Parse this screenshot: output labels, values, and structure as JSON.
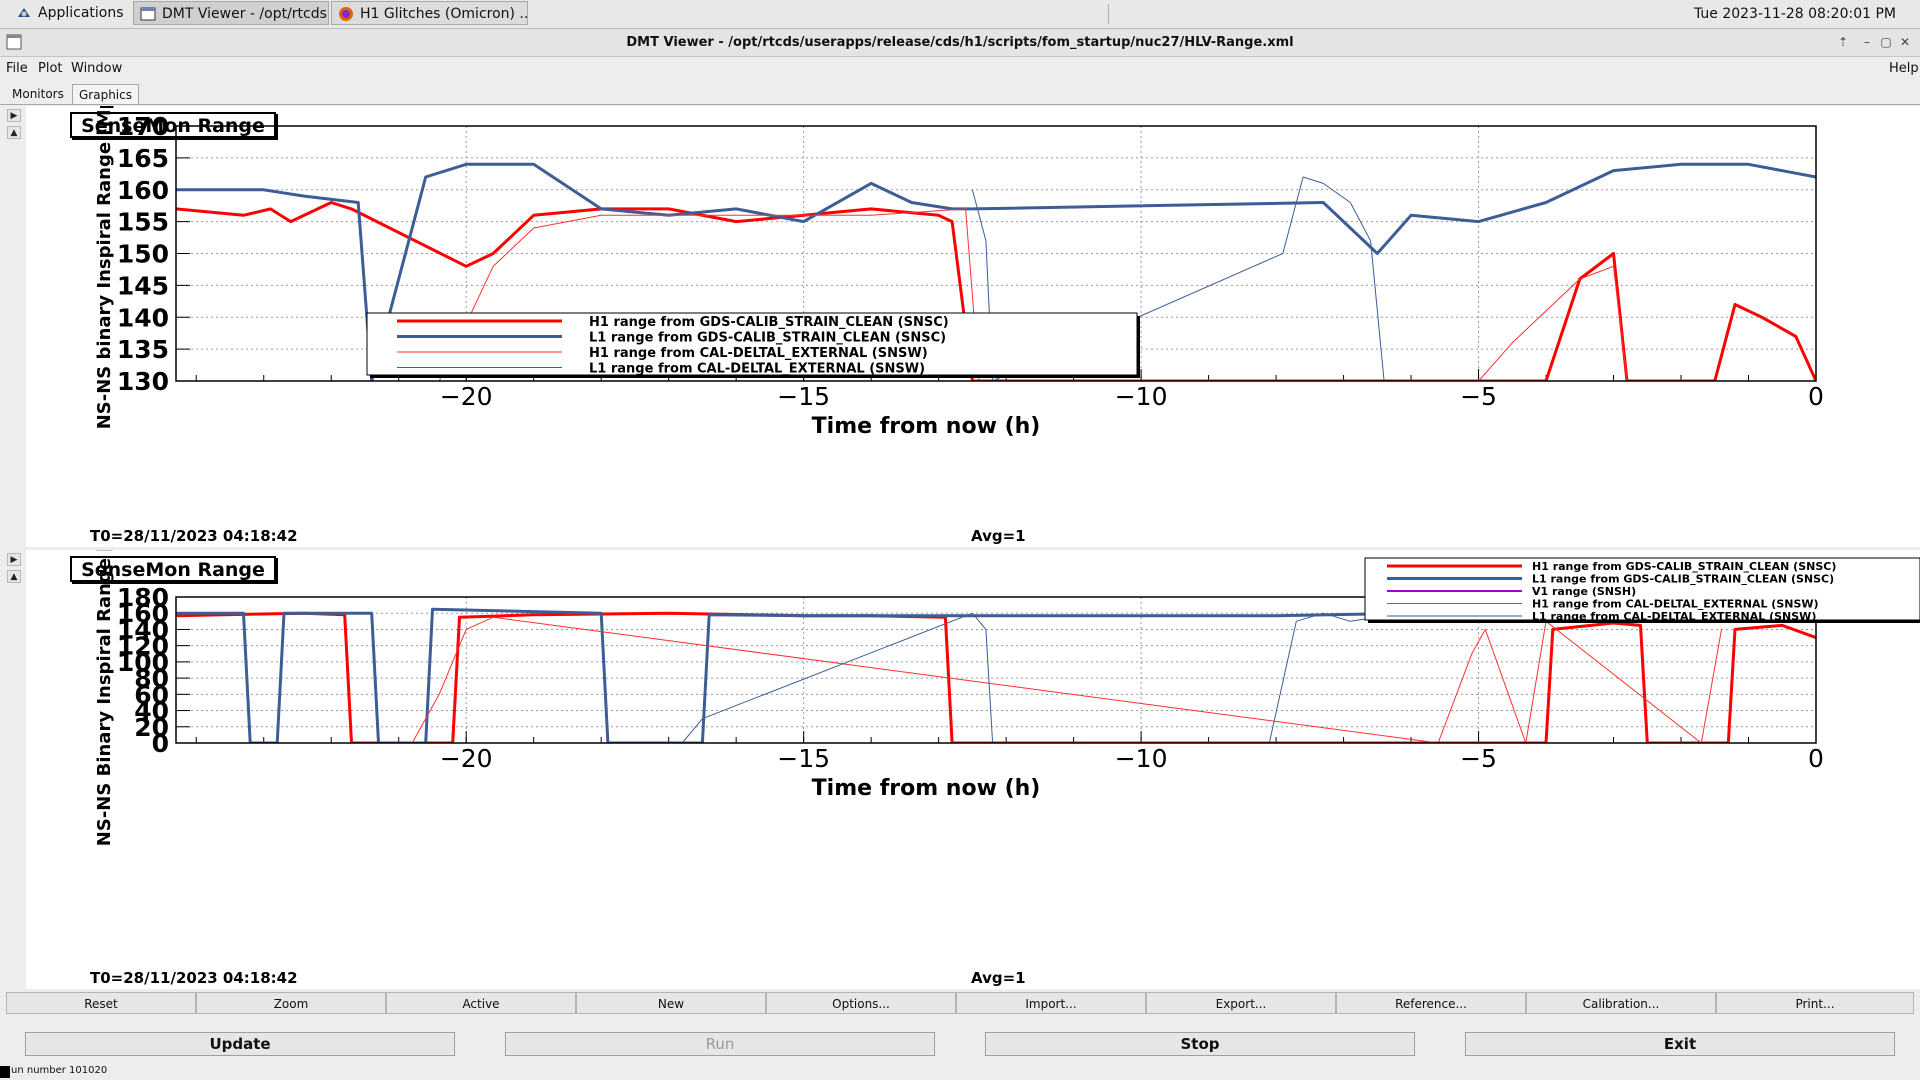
{
  "taskbar": {
    "items": [
      {
        "label": "Applications",
        "icon": "applications-icon"
      },
      {
        "label": "DMT Viewer - /opt/rtcds...",
        "icon": "window-icon"
      },
      {
        "label": "H1 Glitches (Omicron) ...",
        "icon": "firefox-icon"
      }
    ],
    "clock": "Tue 2023-11-28 08:20:01 PM"
  },
  "window": {
    "title": "DMT Viewer - /opt/rtcds/userapps/release/cds/h1/scripts/fom_startup/nuc27/HLV-Range.xml"
  },
  "menu": {
    "file": "File",
    "plot": "Plot",
    "window": "Window",
    "help": "Help"
  },
  "tabs": [
    {
      "label": "Monitors",
      "selected": false
    },
    {
      "label": "Graphics",
      "selected": true
    }
  ],
  "plots": [
    {
      "label": "SenseMon Range",
      "t0": "T0=28/11/2023 04:18:42",
      "avg": "Avg=1"
    },
    {
      "label": "SenseMon Range",
      "t0": "T0=28/11/2023 04:18:42",
      "avg": "Avg=1"
    }
  ],
  "chart_data": [
    {
      "type": "line",
      "title": "SenseMon Range",
      "xlabel": "Time from now (h)",
      "ylabel": "NS-NS binary Inspiral Range [Mpc]",
      "xlim": [
        -24.3,
        0
      ],
      "ylim": [
        130,
        170
      ],
      "xticks": [
        -20,
        -15,
        -10,
        -5,
        0
      ],
      "xtick_labels": [
        "−20",
        "−15",
        "−10",
        "−5",
        "0"
      ],
      "yticks": [
        130,
        135,
        140,
        145,
        150,
        155,
        160,
        165,
        170
      ],
      "grid": true,
      "legend_position": "center-left",
      "series": [
        {
          "name": "H1 range from GDS-CALIB_STRAIN_CLEAN (SNSC)",
          "color": "#ff0000",
          "width": 3,
          "x": [
            -24.3,
            -23.3,
            -22.9,
            -22.6,
            -22.0,
            -21.7,
            -20.0,
            -19.6,
            -19.0,
            -18.0,
            -17.0,
            -16.0,
            -15.0,
            -14.0,
            -13.0,
            -12.8,
            -12.5,
            -4.0,
            -3.5,
            -3.0,
            -2.8,
            -1.5,
            -1.2,
            -0.8,
            -0.3,
            0
          ],
          "y": [
            157,
            156,
            157,
            155,
            158,
            157,
            148,
            150,
            156,
            157,
            157,
            155,
            156,
            157,
            156,
            155,
            130,
            130,
            146,
            150,
            130,
            130,
            142,
            140,
            137,
            130
          ]
        },
        {
          "name": "L1 range from GDS-CALIB_STRAIN_CLEAN (SNSC)",
          "color": "#3d5d96",
          "width": 3,
          "x": [
            -24.3,
            -23.0,
            -22.4,
            -21.6,
            -21.4,
            -20.6,
            -20.0,
            -19.0,
            -18.0,
            -17.0,
            -16.0,
            -15.0,
            -14.0,
            -13.4,
            -12.8,
            -12.5,
            -7.3,
            -6.5,
            -6.0,
            -5.0,
            -4.0,
            -3.0,
            -2.0,
            -1.0,
            0
          ],
          "y": [
            160,
            160,
            159,
            158,
            130,
            162,
            164,
            164,
            157,
            156,
            157,
            155,
            161,
            158,
            157,
            157,
            158,
            150,
            156,
            155,
            158,
            163,
            164,
            164,
            162
          ]
        },
        {
          "name": "H1 range from CAL-DELTAL_EXTERNAL (SNSW)",
          "color": "#ff3030",
          "width": 1,
          "x": [
            -20.4,
            -19.6,
            -19.0,
            -18.0,
            -16.0,
            -14.0,
            -12.6,
            -12.4,
            -5.0,
            -4.5,
            -3.5,
            -3.0,
            -2.8
          ],
          "y": [
            130,
            148,
            154,
            156,
            156,
            156,
            157,
            130,
            130,
            136,
            146,
            148,
            130
          ]
        },
        {
          "name": "L1 range from CAL-DELTAL_EXTERNAL (SNSW)",
          "color": "#3d5d96",
          "width": 1,
          "x": [
            -12.5,
            -12.3,
            -12.2,
            -7.9,
            -7.6,
            -7.3,
            -6.9,
            -6.6,
            -6.4
          ],
          "y": [
            160,
            152,
            130,
            150,
            162,
            161,
            158,
            152,
            130
          ]
        }
      ]
    },
    {
      "type": "line",
      "title": "SenseMon Range",
      "xlabel": "Time from now (h)",
      "ylabel": "NS-NS Binary Inspiral Range [Mpc]",
      "xlim": [
        -24.3,
        0
      ],
      "ylim": [
        0,
        180
      ],
      "xticks": [
        -20,
        -15,
        -10,
        -5,
        0
      ],
      "xtick_labels": [
        "−20",
        "−15",
        "−10",
        "−5",
        "0"
      ],
      "yticks": [
        0,
        20,
        40,
        60,
        80,
        100,
        120,
        140,
        160,
        180
      ],
      "grid": true,
      "legend_position": "top-right",
      "series": [
        {
          "name": "H1 range from GDS-CALIB_STRAIN_CLEAN (SNSC)",
          "color": "#ff0000",
          "width": 3,
          "x": [
            -24.3,
            -22.4,
            -21.8,
            -21.7,
            -20.2,
            -20.1,
            -19.0,
            -17.0,
            -15.0,
            -14.0,
            -12.9,
            -12.8,
            -4.0,
            -3.9,
            -3.0,
            -2.6,
            -2.5,
            -1.3,
            -1.2,
            -0.5,
            0
          ],
          "y": [
            157,
            160,
            158,
            0,
            0,
            155,
            158,
            160,
            157,
            157,
            155,
            0,
            0,
            140,
            148,
            145,
            0,
            0,
            140,
            145,
            130
          ]
        },
        {
          "name": "L1 range from GDS-CALIB_STRAIN_CLEAN (SNSC)",
          "color": "#3d5d96",
          "width": 3,
          "x": [
            -24.3,
            -23.3,
            -23.2,
            -22.8,
            -22.7,
            -21.4,
            -21.3,
            -20.6,
            -20.5,
            -18.0,
            -17.9,
            -16.5,
            -16.4,
            -15.0,
            -13.0,
            -12.5,
            -8.0,
            -6.0,
            -4.0,
            -2.0,
            0
          ],
          "y": [
            160,
            160,
            0,
            0,
            160,
            160,
            0,
            0,
            165,
            160,
            0,
            0,
            158,
            157,
            157,
            157,
            157,
            160,
            162,
            164,
            163
          ]
        },
        {
          "name": "V1 range (SNSH)",
          "color": "#a000e0",
          "width": 2,
          "x": [],
          "y": []
        },
        {
          "name": "H1 range from CAL-DELTAL_EXTERNAL (SNSW)",
          "color": "#ff3030",
          "width": 1,
          "x": [
            -20.8,
            -20.4,
            -20.0,
            -19.6,
            -5.6,
            -5.1,
            -4.9,
            -4.3,
            -4.0,
            -1.7,
            -1.4
          ],
          "y": [
            0,
            60,
            140,
            155,
            0,
            110,
            140,
            0,
            150,
            0,
            140
          ]
        },
        {
          "name": "L1 range from CAL-DELTAL_EXTERNAL (SNSW)",
          "color": "#3d5d96",
          "width": 1,
          "x": [
            -16.8,
            -16.5,
            -12.5,
            -12.3,
            -12.2,
            -8.1,
            -7.7,
            -7.3,
            -6.9,
            -6.5
          ],
          "y": [
            0,
            30,
            160,
            140,
            0,
            0,
            150,
            160,
            150,
            155
          ]
        }
      ]
    }
  ],
  "buttons": [
    "Reset",
    "Zoom",
    "Active",
    "New",
    "Options...",
    "Import...",
    "Export...",
    "Reference...",
    "Calibration...",
    "Print..."
  ],
  "controls": [
    {
      "label": "Update",
      "enabled": true
    },
    {
      "label": "Run",
      "enabled": false
    },
    {
      "label": "Stop",
      "enabled": true
    },
    {
      "label": "Exit",
      "enabled": true
    }
  ],
  "status": "un number 101020"
}
